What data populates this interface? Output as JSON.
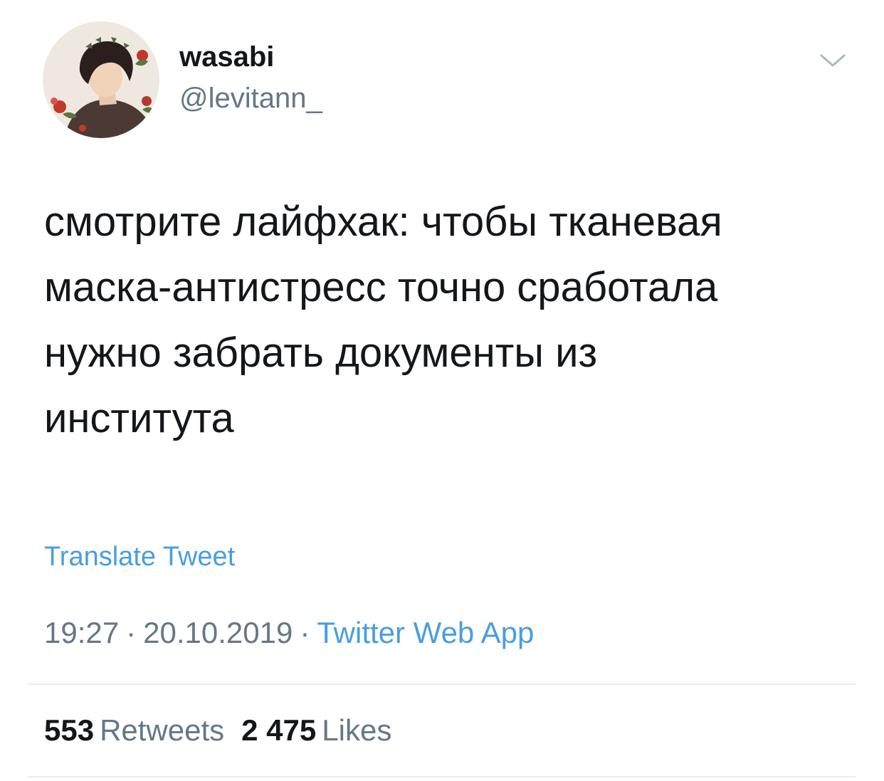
{
  "author": {
    "display_name": "wasabi",
    "handle": "@levitann_"
  },
  "icons": {
    "menu": "chevron-down-icon",
    "avatar": "profile-avatar"
  },
  "tweet": {
    "text_lines": [
      "смотрите лайфхак: чтобы тканевая",
      "маска-антистресс точно сработала",
      "нужно забрать документы из",
      "института"
    ],
    "translate_label": "Translate Tweet",
    "time": "19:27",
    "date": "20.10.2019",
    "separator": "·",
    "source": "Twitter Web App"
  },
  "stats": {
    "retweets_count": "553",
    "retweets_label": "Retweets",
    "likes_count": "2 475",
    "likes_label": "Likes"
  },
  "colors": {
    "link": "#4a9de0",
    "secondary_text": "#657786",
    "primary_text": "#14171a",
    "divider": "#e6ecf0"
  }
}
